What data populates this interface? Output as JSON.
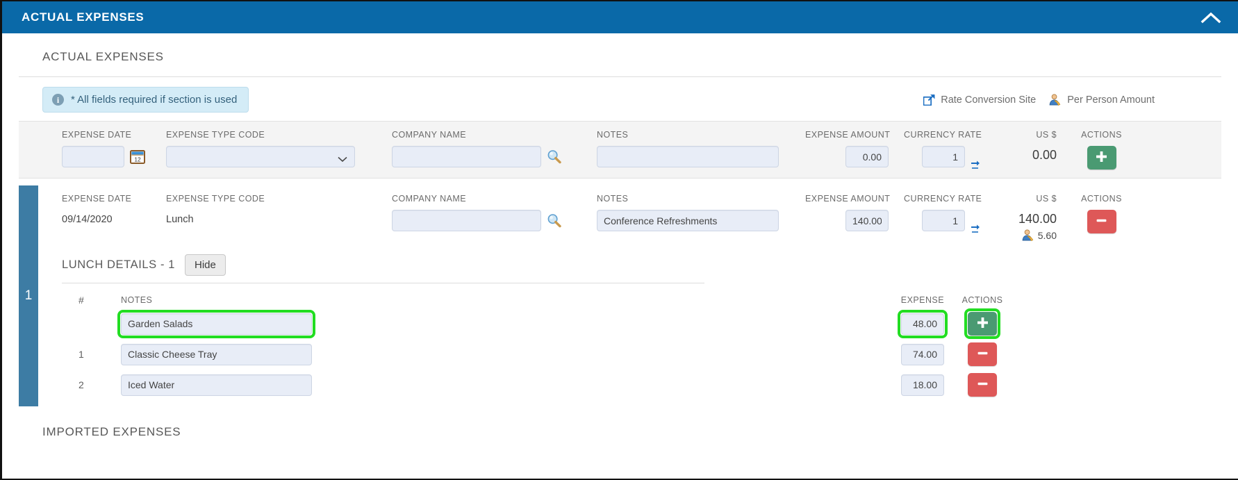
{
  "panel": {
    "header_title": "ACTUAL EXPENSES",
    "collapse_icon": "chevron-up-icon",
    "header_bg": "#0a69a8",
    "section_title": "ACTUAL EXPENSES",
    "footer_title": "IMPORTED EXPENSES"
  },
  "info": {
    "icon": "info-circle-icon",
    "message": "* All fields required if section is used"
  },
  "toplinks": [
    {
      "label": "Rate Conversion Site",
      "icon": "external-link-icon"
    },
    {
      "label": "Per Person Amount",
      "icon": "person-icon"
    }
  ],
  "columns": {
    "expense_date": "EXPENSE DATE",
    "expense_type_code": "EXPENSE TYPE CODE",
    "company_name": "COMPANY NAME",
    "notes": "NOTES",
    "expense_amount": "EXPENSE AMOUNT",
    "currency_rate": "CURRENCY RATE",
    "us_dollar": "US $",
    "actions": "ACTIONS"
  },
  "entry_row": {
    "date_value": "",
    "date_placeholder": "",
    "calendar_icon": "calendar-icon",
    "type_selected": "",
    "type_options": [
      ""
    ],
    "caret_icon": "chevron-down-icon",
    "company_value": "",
    "company_search_icon": "magnifier-icon",
    "notes_value": "",
    "amount_value": "0.00",
    "rate_value": "1",
    "rate_swap_icon": "currency-swap-icon",
    "usd_value": "0.00",
    "action_label": "+",
    "action_icon": "plus-icon",
    "action_color": "#4a9a72"
  },
  "data_row": {
    "row_number": "1",
    "date_value": "09/14/2020",
    "type_value": "Lunch",
    "company_value": "",
    "company_search_icon": "magnifier-icon",
    "notes_value": "Conference Refreshments",
    "amount_value": "140.00",
    "rate_value": "1",
    "rate_swap_icon": "currency-swap-icon",
    "usd_value": "140.00",
    "per_person_icon": "person-icon",
    "per_person_value": "5.60",
    "action_label": "–",
    "action_icon": "minus-icon",
    "action_color": "#de5858"
  },
  "details": {
    "title": "LUNCH DETAILS - 1",
    "hide_button": "Hide",
    "columns": {
      "num": "#",
      "notes": "NOTES",
      "expense": "EXPENSE",
      "actions": "ACTIONS"
    },
    "rows": [
      {
        "num": "",
        "notes": "Garden Salads",
        "expense": "48.00",
        "action_label": "+",
        "action_icon": "plus-icon",
        "action_color": "#4a9a72",
        "highlighted": true
      },
      {
        "num": "1",
        "notes": "Classic Cheese Tray",
        "expense": "74.00",
        "action_label": "–",
        "action_icon": "minus-icon",
        "action_color": "#de5858",
        "highlighted": false
      },
      {
        "num": "2",
        "notes": "Iced Water",
        "expense": "18.00",
        "action_label": "–",
        "action_icon": "minus-icon",
        "action_color": "#de5858",
        "highlighted": false
      }
    ]
  },
  "highlight_color": "#22dd22"
}
